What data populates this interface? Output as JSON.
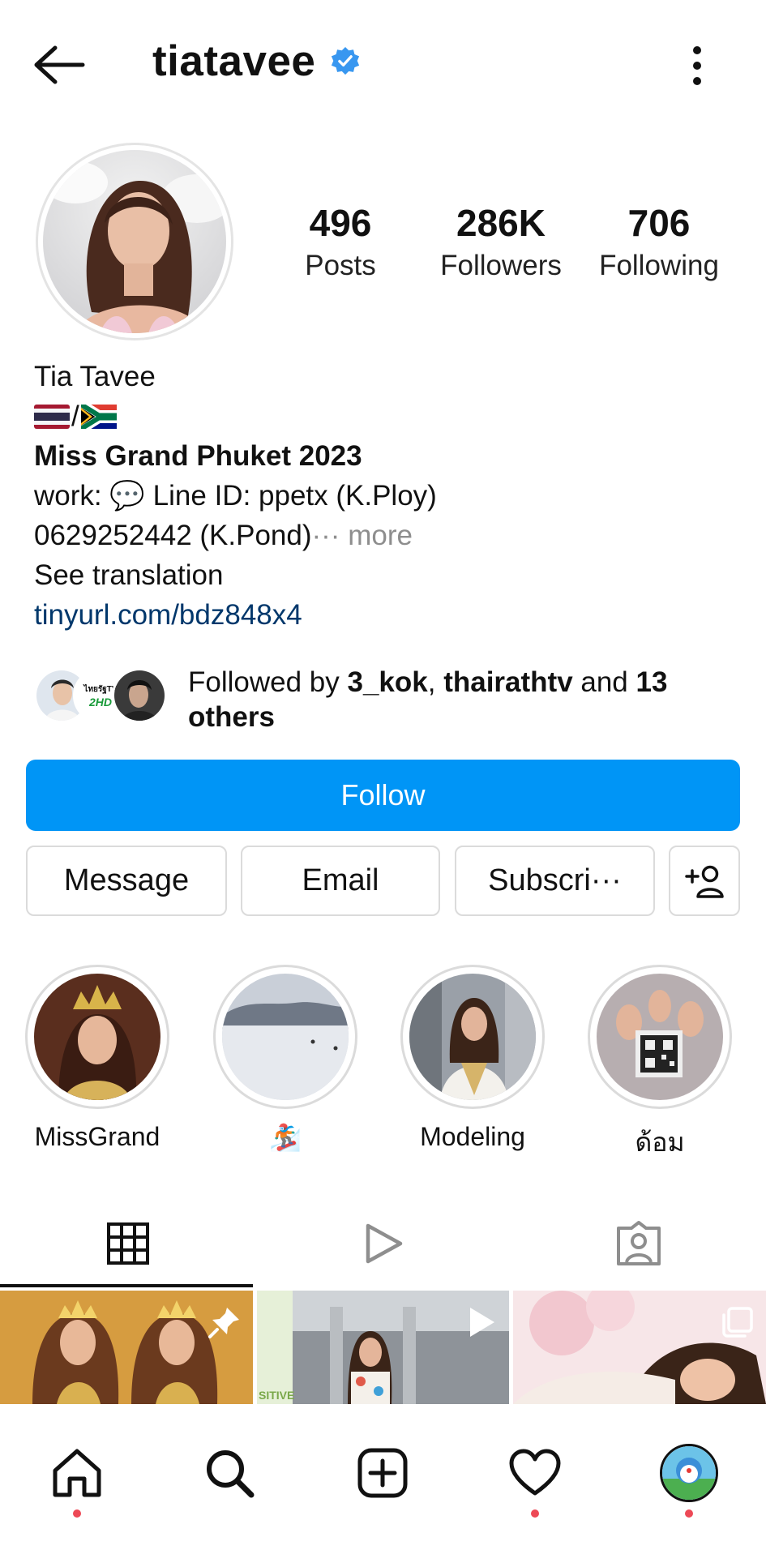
{
  "header": {
    "username": "tiatavee",
    "verified": true
  },
  "stats": {
    "posts_count": "496",
    "posts_label": "Posts",
    "followers_count": "286K",
    "followers_label": "Followers",
    "following_count": "706",
    "following_label": "Following"
  },
  "bio": {
    "full_name": "Tia Tavee",
    "flag_separator": "/",
    "title_line": "Miss Grand Phuket 2023",
    "work_prefix": "work: ",
    "work_icon": "💬",
    "work_line": " Line ID: ppetx (K.Ploy)",
    "phone_line": "0629252442 (K.Pond)",
    "ellipsis": "···",
    "more_label": " more",
    "see_translation": "See translation",
    "link": "tinyurl.com/bdz848x4"
  },
  "followed_by": {
    "prefix": "Followed by ",
    "user1": "3_kok",
    "comma": ", ",
    "user2": "thairathtv",
    "and": " and ",
    "count_others": "13 others",
    "tv_badge_line1": "ไทยรัฐTV",
    "tv_badge_line2": "2HD"
  },
  "actions": {
    "follow": "Follow",
    "message": "Message",
    "email": "Email",
    "subscribe": "Subscri···"
  },
  "highlights": [
    {
      "label": "MissGrand"
    },
    {
      "label": "🏂"
    },
    {
      "label": "Modeling"
    },
    {
      "label": "ด้อม"
    }
  ],
  "grid": {
    "post2_overlay_text": "SITIVE"
  },
  "colors": {
    "accent": "#0095f6",
    "verified": "#3897f0",
    "link": "#00376b",
    "notification_dot": "#ed4956",
    "muted": "#8e8e8e"
  },
  "icons": {
    "back": "arrow-left-icon",
    "more": "vertical-dots-icon",
    "add_user": "person-add-icon",
    "grid_tab": "grid-icon",
    "reels_tab": "play-icon",
    "tagged_tab": "tagged-person-icon",
    "home": "home-icon",
    "search": "search-icon",
    "create": "plus-square-icon",
    "activity": "heart-icon"
  }
}
